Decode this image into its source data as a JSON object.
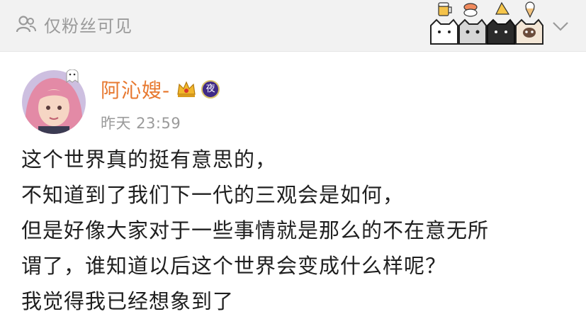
{
  "header": {
    "privacy_label": "仅粉丝可见",
    "privacy_icon": "user-group-icon",
    "sticker_icons": [
      "beer-icon",
      "sushi-icon",
      "cake-icon",
      "ice-cream-icon"
    ],
    "sticker_cat_icons": [
      "white-cat-icon",
      "gray-cat-icon",
      "black-cat-icon",
      "siamese-cat-icon"
    ],
    "expand_icon": "chevron-down-icon"
  },
  "post": {
    "author_name": "阿沁嫂-",
    "vip_badge_icon": "crown-icon",
    "night_badge": "夜",
    "time": "昨天 23:59",
    "lines": [
      "这个世界真的挺有意思的，",
      "不知道到了我们下一代的三观会是如何，",
      "但是好像大家对于一些事情就是那么的不在意无所",
      "谓了，谁知道以后这个世界会变成什么样呢？",
      "我觉得我已经想象到了"
    ]
  },
  "colors": {
    "author_name": "#e7782f",
    "muted_text": "#9a9a9a",
    "body_text": "#1f1f1f",
    "header_bg": "#f2f2f2"
  }
}
